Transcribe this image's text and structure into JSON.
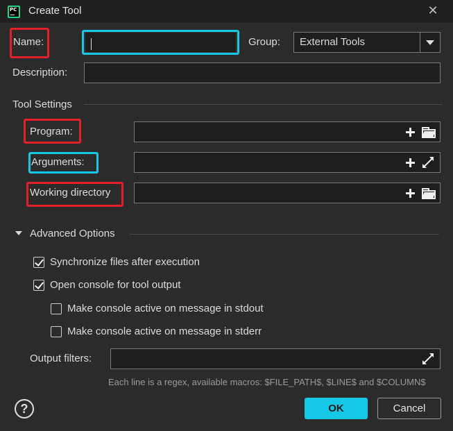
{
  "window": {
    "title": "Create Tool",
    "app_icon_text": "PC"
  },
  "form": {
    "name_label": "Name:",
    "name_value": "",
    "group_label": "Group:",
    "group_value": "External Tools",
    "description_label": "Description:",
    "description_value": ""
  },
  "tool_settings": {
    "heading": "Tool Settings",
    "program_label": "Program:",
    "program_value": "",
    "arguments_label": "Arguments:",
    "arguments_value": "",
    "working_dir_label": "Working directory",
    "working_dir_value": ""
  },
  "advanced": {
    "heading": "Advanced Options",
    "expanded": true,
    "checkboxes": [
      {
        "label": "Synchronize files after execution",
        "checked": true
      },
      {
        "label": "Open console for tool output",
        "checked": true
      },
      {
        "label": "Make console active on message in stdout",
        "checked": false
      },
      {
        "label": "Make console active on message in stderr",
        "checked": false
      }
    ],
    "output_filters_label": "Output filters:",
    "output_filters_value": "",
    "hint": "Each line is a regex, available macros: $FILE_PATH$, $LINE$ and $COLUMN$"
  },
  "buttons": {
    "help": "?",
    "ok": "OK",
    "cancel": "Cancel"
  },
  "icons": {
    "close": "close-icon",
    "dropdown": "chevron-down-icon",
    "add": "plus-icon",
    "browse": "folder-icon",
    "expand": "expand-icon",
    "section_toggle": "triangle-down-icon",
    "help": "help-icon"
  },
  "colors": {
    "background": "#2b2b2b",
    "titlebar": "#1f1f1f",
    "accent": "#14c8e6",
    "annotation_red": "#e5202b",
    "annotation_cyan": "#14c8e6"
  }
}
